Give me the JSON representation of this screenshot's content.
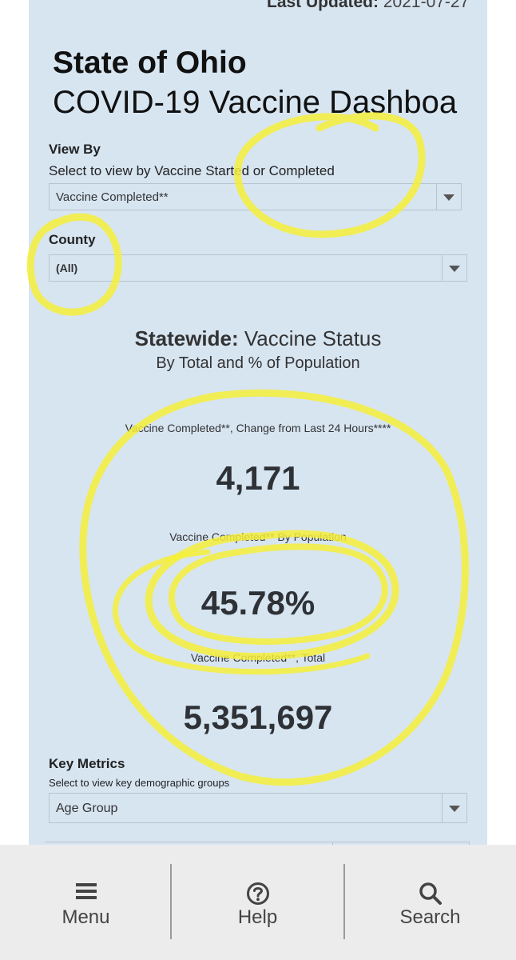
{
  "header": {
    "last_updated_label": "Last Updated:",
    "last_updated_value": "2021-07-27",
    "title_line1": "State of Ohio",
    "title_line2": "COVID-19 Vaccine Dashboa"
  },
  "view_by": {
    "label": "View By",
    "help": "Select to view by Vaccine Started or Completed",
    "selected": "Vaccine Completed**"
  },
  "county": {
    "label": "County",
    "selected": "(All)"
  },
  "statewide": {
    "bold": "Statewide:",
    "rest": "Vaccine Status",
    "subtitle": "By Total and % of Population"
  },
  "metrics": [
    {
      "label": "Vaccine Completed**, Change from Last 24 Hours****",
      "value": "4,171"
    },
    {
      "label": "Vaccine Completed** By Population",
      "value": "45.78%"
    },
    {
      "label": "Vaccine Completed**, Total",
      "value": "5,351,697"
    }
  ],
  "key_metrics": {
    "label": "Key Metrics",
    "help": "Select to view key demographic groups",
    "selected": "Age Group"
  },
  "bottom_nav": [
    {
      "label": "Menu",
      "icon": "menu-icon"
    },
    {
      "label": "Help",
      "icon": "help-icon"
    },
    {
      "label": "Search",
      "icon": "search-icon"
    }
  ],
  "colors": {
    "panel_bg": "#d7e5f1",
    "highlight_scribble": "#f6ee3a",
    "bottom_bar_bg": "#ececec"
  }
}
